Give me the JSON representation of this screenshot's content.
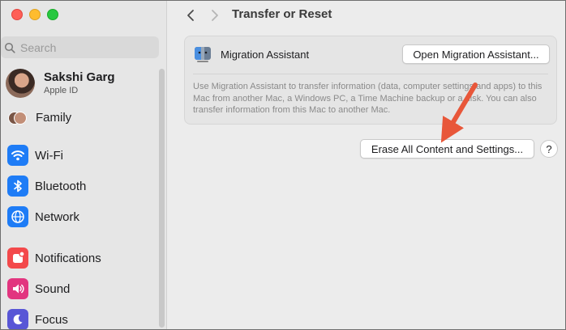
{
  "window": {
    "title": "Transfer or Reset"
  },
  "sidebar": {
    "search_placeholder": "Search",
    "profile": {
      "name": "Sakshi Garg",
      "subtitle": "Apple ID"
    },
    "family_label": "Family",
    "items": [
      {
        "label": "Wi-Fi",
        "icon": "wifi-icon",
        "color": "#1e7cf6"
      },
      {
        "label": "Bluetooth",
        "icon": "bluetooth-icon",
        "color": "#1e7cf6"
      },
      {
        "label": "Network",
        "icon": "globe-icon",
        "color": "#1e7cf6"
      },
      {
        "label": "Notifications",
        "icon": "bell-icon",
        "color": "#f3494b"
      },
      {
        "label": "Sound",
        "icon": "speaker-icon",
        "color": "#e2357f"
      },
      {
        "label": "Focus",
        "icon": "moon-icon",
        "color": "#5856d6"
      }
    ]
  },
  "main": {
    "migration": {
      "label": "Migration Assistant",
      "button": "Open Migration Assistant...",
      "description": "Use Migration Assistant to transfer information (data, computer settings and apps) to this Mac from another Mac, a Windows PC, a Time Machine backup or a disk. You can also transfer information from this Mac to another Mac."
    },
    "erase_button": "Erase All Content and Settings...",
    "help_label": "?"
  },
  "annotation": {
    "arrow_color": "#e8573a"
  }
}
